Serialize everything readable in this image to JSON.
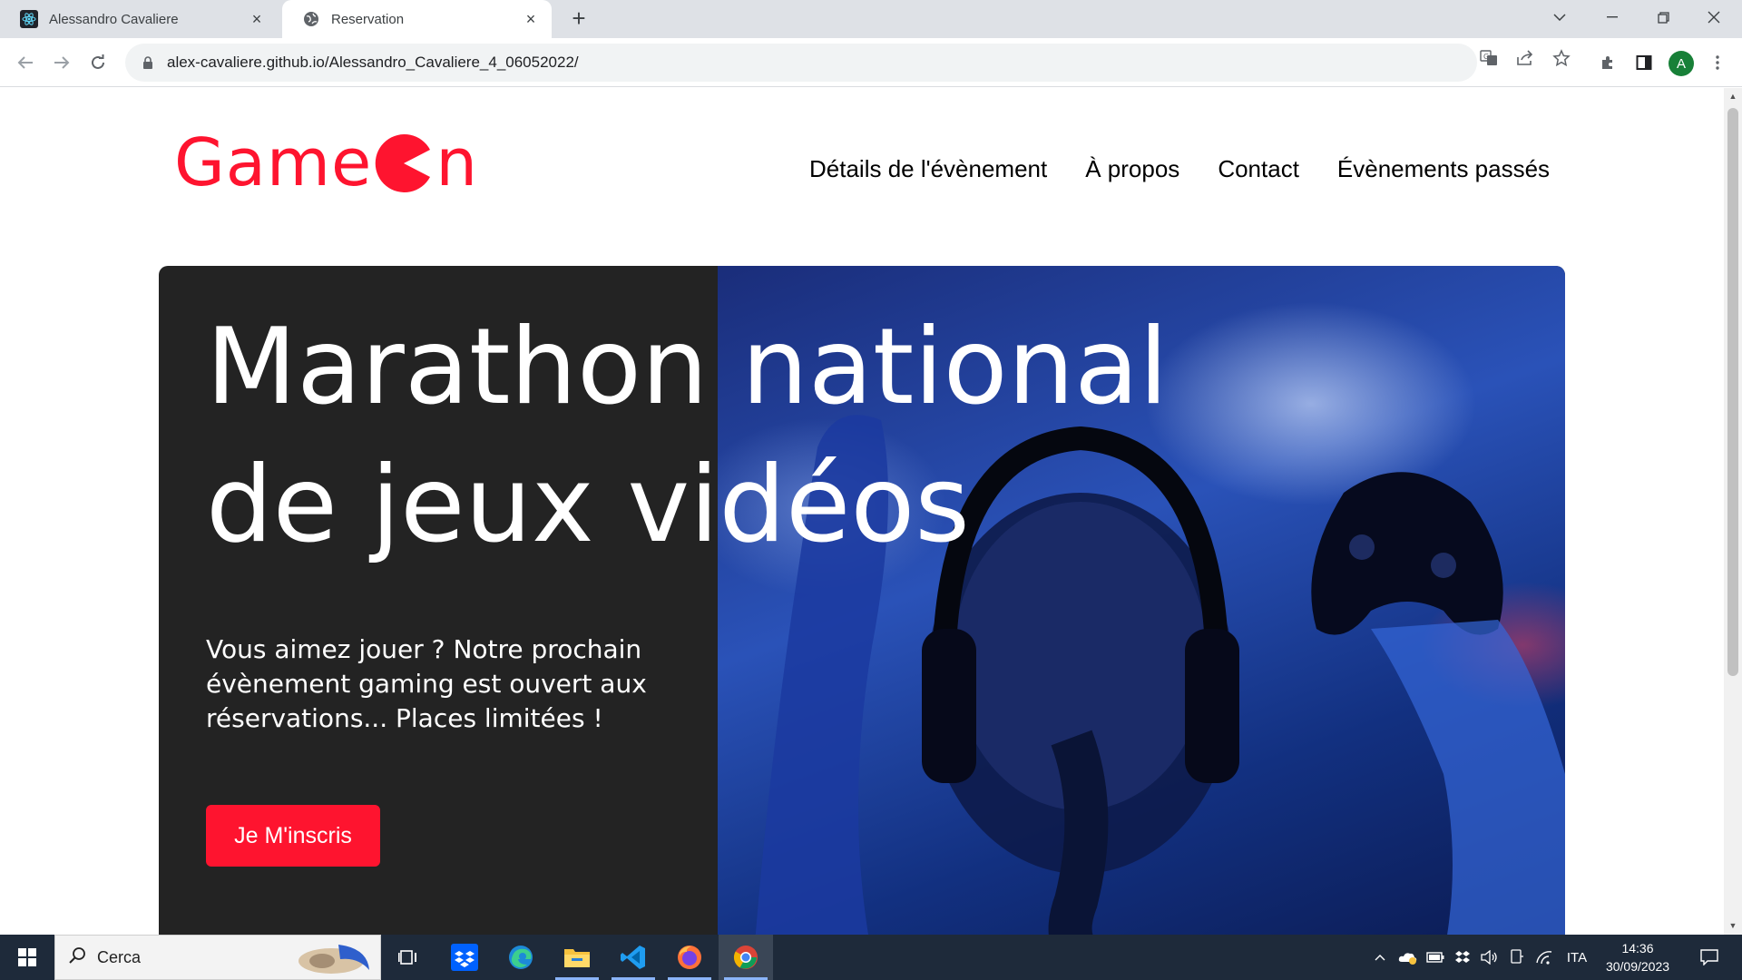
{
  "browser": {
    "tabs": [
      {
        "title": "Alessandro Cavaliere",
        "active": false
      },
      {
        "title": "Reservation",
        "active": true
      }
    ],
    "url": "alex-cavaliere.github.io/Alessandro_Cavaliere_4_06052022/",
    "profile_initial": "A"
  },
  "site": {
    "logo": {
      "left": "Game",
      "right": "n"
    },
    "nav": [
      {
        "label": "Détails de l'évènement"
      },
      {
        "label": "À propos"
      },
      {
        "label": "Contact"
      },
      {
        "label": "Évènements passés"
      }
    ],
    "hero": {
      "title_line1": "Marathon national",
      "title_line2": "de jeux vidéos",
      "text": "Vous aimez jouer ? Notre prochain évènement gaming est ouvert aux réservations... Places limitées !",
      "cta": "Je M'inscris"
    }
  },
  "taskbar": {
    "search_placeholder": "Cerca",
    "language": "ITA",
    "time": "14:36",
    "date": "30/09/2023"
  },
  "colors": {
    "brand_red": "#fe142f",
    "hero_dark": "#232323"
  }
}
